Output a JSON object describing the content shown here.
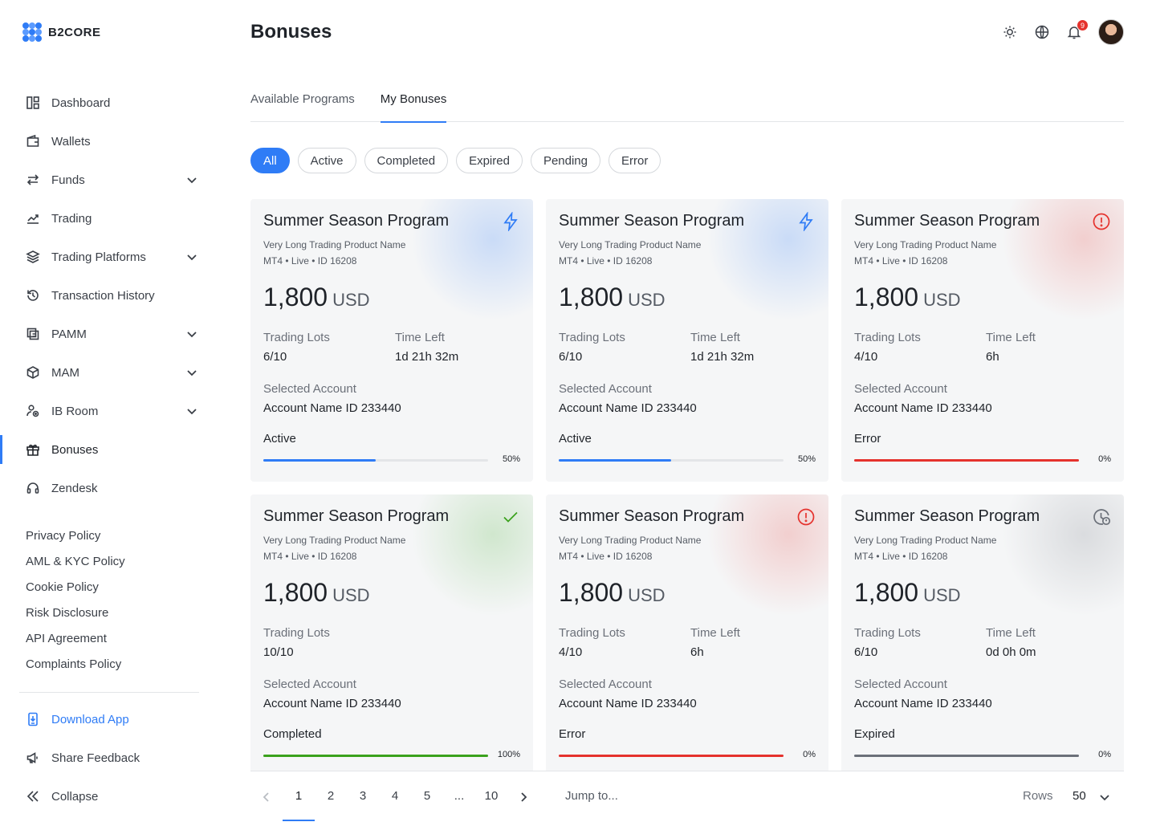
{
  "app": {
    "logo_text": "B2CORE"
  },
  "header": {
    "title": "Bonuses",
    "notification_count": "9",
    "icons": [
      "sun-icon",
      "globe-icon",
      "bell-icon"
    ]
  },
  "sidebar": {
    "items": [
      {
        "label": "Dashboard",
        "icon": "dashboard-icon",
        "expandable": false
      },
      {
        "label": "Wallets",
        "icon": "wallet-icon",
        "expandable": false
      },
      {
        "label": "Funds",
        "icon": "transfer-icon",
        "expandable": true
      },
      {
        "label": "Trading",
        "icon": "chart-icon",
        "expandable": false
      },
      {
        "label": "Trading Platforms",
        "icon": "layers-icon",
        "expandable": true
      },
      {
        "label": "Transaction History",
        "icon": "history-icon",
        "expandable": false
      },
      {
        "label": "PAMM",
        "icon": "pamm-icon",
        "expandable": true
      },
      {
        "label": "MAM",
        "icon": "cube-icon",
        "expandable": true
      },
      {
        "label": "IB Room",
        "icon": "ib-icon",
        "expandable": true
      },
      {
        "label": "Bonuses",
        "icon": "gift-icon",
        "expandable": false,
        "active": true
      },
      {
        "label": "Zendesk",
        "icon": "headset-icon",
        "expandable": false
      }
    ],
    "policies": [
      "Privacy Policy",
      "AML & KYC Policy",
      "Cookie Policy",
      "Risk Disclosure",
      "API Agreement",
      "Complaints Policy"
    ],
    "footer": {
      "download_label": "Download App",
      "feedback_label": "Share Feedback",
      "collapse_label": "Collapse"
    }
  },
  "tabs": [
    {
      "label": "Available Programs",
      "active": false
    },
    {
      "label": "My Bonuses",
      "active": true
    }
  ],
  "filters": [
    {
      "label": "All",
      "active": true
    },
    {
      "label": "Active",
      "active": false
    },
    {
      "label": "Completed",
      "active": false
    },
    {
      "label": "Expired",
      "active": false
    },
    {
      "label": "Pending",
      "active": false
    },
    {
      "label": "Error",
      "active": false
    }
  ],
  "labels": {
    "trading_lots": "Trading Lots",
    "time_left": "Time Left",
    "selected_account": "Selected Account"
  },
  "colors": {
    "accent": "#2f7cf6",
    "active": "#2f7cf6",
    "error": "#e5322d",
    "completed": "#3aa11c",
    "expired": "#6b7079"
  },
  "cards": [
    {
      "title": "Summer Season Program",
      "product": "Very Long Trading Product Name",
      "meta": "MT4 • Live • ID 16208",
      "amount": "1,800",
      "currency": "USD",
      "lots": "6/10",
      "time_left": "1d 21h 32m",
      "account": "Account Name ID 233440",
      "status": "Active",
      "progress": 0.5,
      "progress_label": "50%",
      "kind": "active",
      "icon": "lightning-icon"
    },
    {
      "title": "Summer Season Program",
      "product": "Very Long Trading Product Name",
      "meta": "MT4 • Live • ID 16208",
      "amount": "1,800",
      "currency": "USD",
      "lots": "6/10",
      "time_left": "1d 21h 32m",
      "account": "Account Name ID 233440",
      "status": "Active",
      "progress": 0.5,
      "progress_label": "50%",
      "kind": "active",
      "icon": "lightning-icon"
    },
    {
      "title": "Summer Season Program",
      "product": "Very Long Trading Product Name",
      "meta": "MT4 • Live • ID 16208",
      "amount": "1,800",
      "currency": "USD",
      "lots": "4/10",
      "time_left": "6h",
      "account": "Account Name ID 233440",
      "status": "Error",
      "progress": 1.0,
      "progress_label": "0%",
      "kind": "error",
      "icon": "alert-circle-icon"
    },
    {
      "title": "Summer Season Program",
      "product": "Very Long Trading Product Name",
      "meta": "MT4 • Live • ID 16208",
      "amount": "1,800",
      "currency": "USD",
      "lots": "10/10",
      "time_left": "",
      "account": "Account Name ID 233440",
      "status": "Completed",
      "progress": 1.0,
      "progress_label": "100%",
      "kind": "completed",
      "icon": "check-icon"
    },
    {
      "title": "Summer Season Program",
      "product": "Very Long Trading Product Name",
      "meta": "MT4 • Live • ID 16208",
      "amount": "1,800",
      "currency": "USD",
      "lots": "4/10",
      "time_left": "6h",
      "account": "Account Name ID 233440",
      "status": "Error",
      "progress": 1.0,
      "progress_label": "0%",
      "kind": "error",
      "icon": "alert-circle-icon"
    },
    {
      "title": "Summer Season Program",
      "product": "Very Long Trading Product Name",
      "meta": "MT4 • Live • ID 16208",
      "amount": "1,800",
      "currency": "USD",
      "lots": "6/10",
      "time_left": "0d 0h 0m",
      "account": "Account Name ID 233440",
      "status": "Expired",
      "progress": 1.0,
      "progress_label": "0%",
      "kind": "expired",
      "icon": "clock-alert-icon"
    }
  ],
  "pagination": {
    "pages": [
      "1",
      "2",
      "3",
      "4",
      "5",
      "...",
      "10"
    ],
    "current": "1",
    "jump_placeholder": "Jump to...",
    "rows_label": "Rows",
    "rows_value": "50"
  }
}
